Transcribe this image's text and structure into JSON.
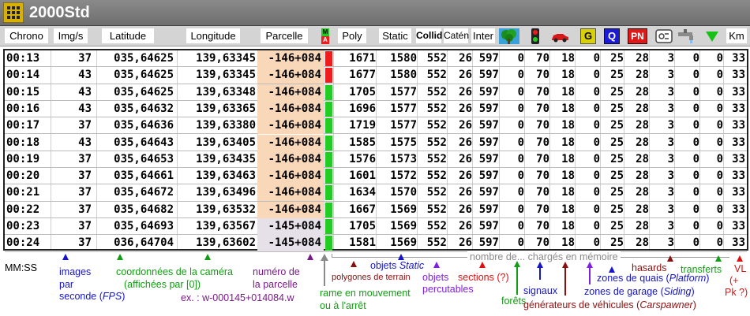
{
  "app": {
    "title": "2000Std"
  },
  "header": {
    "chrono": "Chrono",
    "imgs": "Img/s",
    "latitude": "Latitude",
    "longitude": "Longitude",
    "parcelle": "Parcelle",
    "ma_top": "M",
    "ma_bottom": "A",
    "poly": "Poly",
    "static": "Static",
    "collid": "Collid",
    "caten": "Catén",
    "inter": "Inter",
    "g_badge": "G",
    "q_badge": "Q",
    "pn_badge": "PN",
    "km": "Km"
  },
  "rows": [
    {
      "chrono": "00:13",
      "imgs": "37",
      "lat": "035,64625",
      "lon": "139,63345",
      "parcelle": "-146+084",
      "ma": "red",
      "poly": "1671",
      "static": "1580",
      "collid": "552",
      "caten": "26",
      "inter": "597",
      "c1": "0",
      "c2": "70",
      "c3": "18",
      "c4": "0",
      "c5": "25",
      "c6": "28",
      "c7": "3",
      "c8": "0",
      "c9": "0",
      "c10": "33"
    },
    {
      "chrono": "00:14",
      "imgs": "43",
      "lat": "035,64625",
      "lon": "139,63345",
      "parcelle": "-146+084",
      "ma": "red",
      "poly": "1677",
      "static": "1580",
      "collid": "552",
      "caten": "26",
      "inter": "597",
      "c1": "0",
      "c2": "70",
      "c3": "18",
      "c4": "0",
      "c5": "25",
      "c6": "28",
      "c7": "3",
      "c8": "0",
      "c9": "0",
      "c10": "33"
    },
    {
      "chrono": "00:15",
      "imgs": "43",
      "lat": "035,64625",
      "lon": "139,63348",
      "parcelle": "-146+084",
      "ma": "green",
      "poly": "1705",
      "static": "1577",
      "collid": "552",
      "caten": "26",
      "inter": "597",
      "c1": "0",
      "c2": "70",
      "c3": "18",
      "c4": "0",
      "c5": "25",
      "c6": "28",
      "c7": "3",
      "c8": "0",
      "c9": "0",
      "c10": "33"
    },
    {
      "chrono": "00:16",
      "imgs": "43",
      "lat": "035,64632",
      "lon": "139,63365",
      "parcelle": "-146+084",
      "ma": "green",
      "poly": "1696",
      "static": "1577",
      "collid": "552",
      "caten": "26",
      "inter": "597",
      "c1": "0",
      "c2": "70",
      "c3": "18",
      "c4": "0",
      "c5": "25",
      "c6": "28",
      "c7": "3",
      "c8": "0",
      "c9": "0",
      "c10": "33"
    },
    {
      "chrono": "00:17",
      "imgs": "37",
      "lat": "035,64636",
      "lon": "139,63380",
      "parcelle": "-146+084",
      "ma": "green",
      "poly": "1719",
      "static": "1577",
      "collid": "552",
      "caten": "26",
      "inter": "597",
      "c1": "0",
      "c2": "70",
      "c3": "18",
      "c4": "0",
      "c5": "25",
      "c6": "28",
      "c7": "3",
      "c8": "0",
      "c9": "0",
      "c10": "33"
    },
    {
      "chrono": "00:18",
      "imgs": "43",
      "lat": "035,64643",
      "lon": "139,63405",
      "parcelle": "-146+084",
      "ma": "green",
      "poly": "1585",
      "static": "1575",
      "collid": "552",
      "caten": "26",
      "inter": "597",
      "c1": "0",
      "c2": "70",
      "c3": "18",
      "c4": "0",
      "c5": "25",
      "c6": "28",
      "c7": "3",
      "c8": "0",
      "c9": "0",
      "c10": "33"
    },
    {
      "chrono": "00:19",
      "imgs": "37",
      "lat": "035,64653",
      "lon": "139,63435",
      "parcelle": "-146+084",
      "ma": "green",
      "poly": "1576",
      "static": "1573",
      "collid": "552",
      "caten": "26",
      "inter": "597",
      "c1": "0",
      "c2": "70",
      "c3": "18",
      "c4": "0",
      "c5": "25",
      "c6": "28",
      "c7": "3",
      "c8": "0",
      "c9": "0",
      "c10": "33"
    },
    {
      "chrono": "00:20",
      "imgs": "37",
      "lat": "035,64661",
      "lon": "139,63463",
      "parcelle": "-146+084",
      "ma": "green",
      "poly": "1601",
      "static": "1572",
      "collid": "552",
      "caten": "26",
      "inter": "597",
      "c1": "0",
      "c2": "70",
      "c3": "18",
      "c4": "0",
      "c5": "25",
      "c6": "28",
      "c7": "3",
      "c8": "0",
      "c9": "0",
      "c10": "33"
    },
    {
      "chrono": "00:21",
      "imgs": "37",
      "lat": "035,64672",
      "lon": "139,63496",
      "parcelle": "-146+084",
      "ma": "green",
      "poly": "1634",
      "static": "1570",
      "collid": "552",
      "caten": "26",
      "inter": "597",
      "c1": "0",
      "c2": "70",
      "c3": "18",
      "c4": "0",
      "c5": "25",
      "c6": "28",
      "c7": "3",
      "c8": "0",
      "c9": "0",
      "c10": "33"
    },
    {
      "chrono": "00:22",
      "imgs": "37",
      "lat": "035,64682",
      "lon": "139,63532",
      "parcelle": "-146+084",
      "ma": "green",
      "poly": "1667",
      "static": "1569",
      "collid": "552",
      "caten": "26",
      "inter": "597",
      "c1": "0",
      "c2": "70",
      "c3": "18",
      "c4": "0",
      "c5": "25",
      "c6": "28",
      "c7": "3",
      "c8": "0",
      "c9": "0",
      "c10": "33"
    },
    {
      "chrono": "00:23",
      "imgs": "37",
      "lat": "035,64693",
      "lon": "139,63567",
      "parcelle": "-145+084",
      "ma": "green",
      "poly": "1705",
      "static": "1569",
      "collid": "552",
      "caten": "26",
      "inter": "597",
      "c1": "0",
      "c2": "70",
      "c3": "18",
      "c4": "0",
      "c5": "25",
      "c6": "28",
      "c7": "3",
      "c8": "0",
      "c9": "0",
      "c10": "33"
    },
    {
      "chrono": "00:24",
      "imgs": "37",
      "lat": "036,64704",
      "lon": "139,63602",
      "parcelle": "-145+084",
      "ma": "green",
      "poly": "1581",
      "static": "1569",
      "collid": "552",
      "caten": "26",
      "inter": "597",
      "c1": "0",
      "c2": "70",
      "c3": "18",
      "c4": "0",
      "c5": "25",
      "c6": "28",
      "c7": "3",
      "c8": "0",
      "c9": "0",
      "c10": "33"
    }
  ],
  "annotations": {
    "mmss": "MM:SS",
    "images": [
      "images",
      "par",
      "seconde ("
    ],
    "fps": "FPS",
    "fps_close": ")",
    "coords": [
      "coordonnées de la caméra",
      "(affichées par [0])"
    ],
    "parcelle": [
      "numéro de",
      "la parcelle"
    ],
    "parcelle_ex": "ex. : w-000145+014084.w",
    "rame": [
      "rame en mouvement",
      "ou à l'arrêt"
    ],
    "polygones": "polygones de terrain",
    "objets_static_prefix": "objets ",
    "objets_static_em": "Static",
    "objets_percutables": [
      "objets",
      "percutables"
    ],
    "nombre": "nombre de... chargés en mémoire",
    "sections": "sections (?)",
    "forets": "forêts",
    "signaux": "signaux",
    "generateurs_prefix": "générateurs de véhicules (",
    "generateurs_em": "Carspawner",
    "generateurs_suffix": ")",
    "garage_prefix": "zones de garage (",
    "garage_em": "Siding",
    "garage_suffix": ")",
    "quais_prefix": "zones de quais (",
    "quais_em": "Platform",
    "quais_suffix": ")",
    "hasards": "hasards",
    "transferts": "transferts",
    "vl": [
      "VL",
      "(+",
      "Pk ?)"
    ]
  },
  "colors": {
    "red": "#ee1c1c",
    "green": "#22cc22",
    "parcelle_bg": "#f8d8b8",
    "parcelle_alt_bg": "#e6e0e8",
    "blue_text": "#1515c8",
    "green_text": "#129e12",
    "purple_text": "#7a1a8a",
    "darkred_text": "#8a1010",
    "red_text": "#dd1010",
    "violet_text": "#7f20e0"
  }
}
